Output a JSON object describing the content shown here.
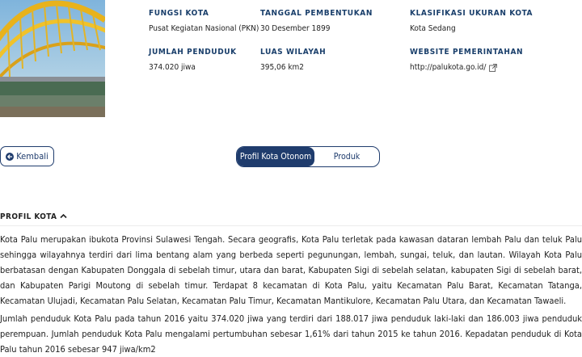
{
  "info": {
    "col1": [
      {
        "label": "FUNGSI KOTA",
        "value": "Pusat Kegiatan Nasional (PKN)"
      },
      {
        "label": "JUMLAH PENDUDUK",
        "value": "374.020 jiwa"
      }
    ],
    "col2": [
      {
        "label": "TANGGAL PEMBENTUKAN",
        "value": "30 Desember 1899"
      },
      {
        "label": "LUAS WILAYAH",
        "value": "395,06 km2"
      }
    ],
    "col3": [
      {
        "label": "KLASIFIKASI UKURAN KOTA",
        "value": "Kota Sedang"
      },
      {
        "label": "WEBSITE PEMERINTAHAN",
        "value": "http://palukota.go.id/"
      }
    ]
  },
  "buttons": {
    "back_label": "Kembali",
    "tab_profile": "Profil Kota Otonom",
    "tab_product": "Produk"
  },
  "section": {
    "title": "PROFIL KOTA",
    "paragraph1": "Kota Palu merupakan ibukota Provinsi Sulawesi Tengah. Secara geografis, Kota Palu terletak pada kawasan dataran lembah Palu dan teluk Palu sehingga wilayahnya terdiri dari lima bentang alam yang berbeda seperti pegunungan, lembah, sungai, teluk, dan lautan. Wilayah Kota Palu berbatasan dengan Kabupaten Donggala di sebelah timur, utara dan barat, Kabupaten Sigi di sebelah selatan, kabupaten Sigi di sebelah barat, dan Kabupaten Parigi Moutong di sebelah timur. Terdapat 8 kecamatan di Kota Palu, yaitu Kecamatan Palu Barat, Kecamatan Tatanga, Kecamatan Ulujadi, Kecamatan Palu Selatan, Kecamatan Palu Timur, Kecamatan Mantikulore, Kecamatan Palu Utara, dan Kecamatan Tawaeli.",
    "paragraph2": "Jumlah penduduk Kota Palu pada tahun 2016 yaitu 374.020 jiwa yang terdiri dari 188.017 jiwa penduduk laki-laki dan 186.003 jiwa penduduk perempuan. Jumlah penduduk Kota Palu mengalami pertumbuhan sebesar 1,61% dari tahun 2015 ke tahun 2016. Kepadatan penduduk di Kota Palu tahun 2016 sebesar 947 jiwa/km2"
  },
  "icons": {
    "external_link": "external-link-icon",
    "back": "arrow-left-circle-icon",
    "collapse": "chevron-up-icon"
  },
  "colors": {
    "accent": "#1f3c6d",
    "label": "#1a3f6b"
  }
}
